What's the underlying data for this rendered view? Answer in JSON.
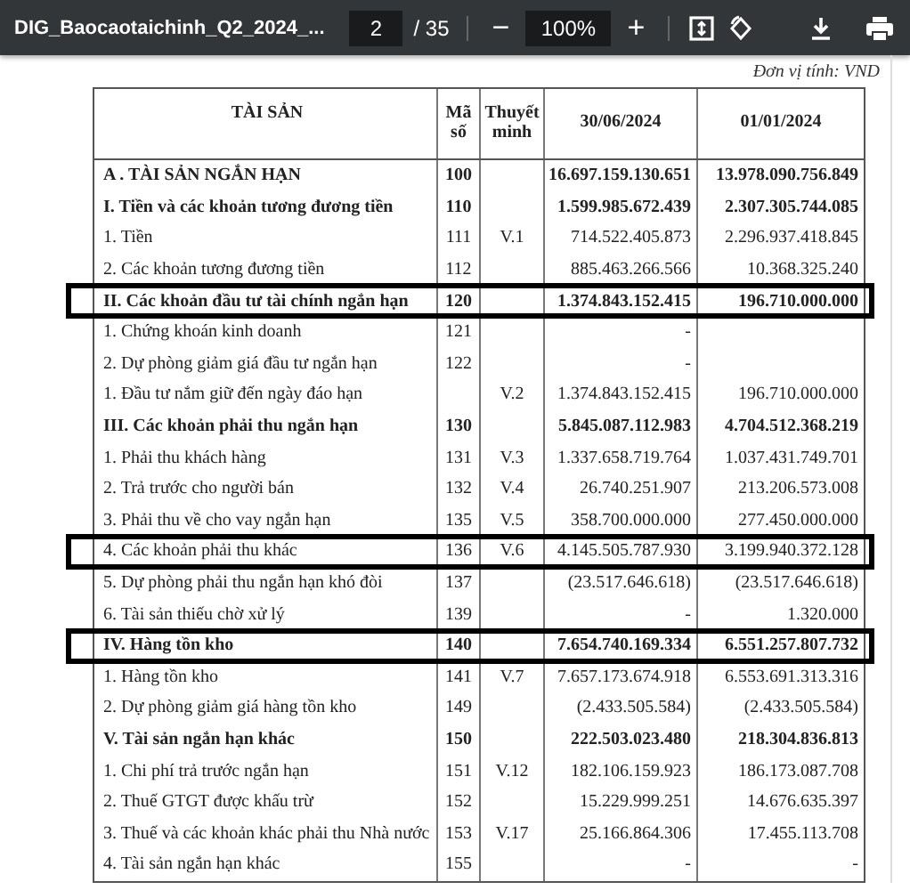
{
  "toolbar": {
    "file_name": "DIG_Baocaotaichinh_Q2_2024_...",
    "page_number": "2",
    "page_count": "/ 35",
    "zoom": "100%",
    "zoom_out": "−",
    "zoom_in": "+"
  },
  "unit": "Đơn vị tính: VND",
  "table": {
    "columns": [
      "TÀI SẢN",
      "Mã số",
      "Thuyết minh",
      "30/06/2024",
      "01/01/2024"
    ],
    "rows": [
      {
        "cells": [
          "A . TÀI SẢN NGẮN HẠN",
          "100",
          "",
          "16.697.159.130.651",
          "13.978.090.756.849"
        ],
        "bold": true,
        "highlighted": false
      },
      {
        "cells": [
          "I. Tiền và các khoản tương đương tiền",
          "110",
          "",
          "1.599.985.672.439",
          "2.307.305.744.085"
        ],
        "bold": true,
        "highlighted": false
      },
      {
        "cells": [
          "1. Tiền",
          "111",
          "V.1",
          "714.522.405.873",
          "2.296.937.418.845"
        ],
        "bold": false,
        "highlighted": false
      },
      {
        "cells": [
          "2. Các khoản tương đương tiền",
          "112",
          "",
          "885.463.266.566",
          "10.368.325.240"
        ],
        "bold": false,
        "highlighted": false
      },
      {
        "cells": [
          "II. Các khoản đầu tư tài chính ngắn hạn",
          "120",
          "",
          "1.374.843.152.415",
          "196.710.000.000"
        ],
        "bold": true,
        "highlighted": true
      },
      {
        "cells": [
          "1. Chứng khoán kinh doanh",
          "121",
          "",
          "-",
          ""
        ],
        "bold": false,
        "highlighted": false
      },
      {
        "cells": [
          "2. Dự phòng giảm giá đầu tư ngắn hạn",
          "122",
          "",
          "-",
          ""
        ],
        "bold": false,
        "highlighted": false
      },
      {
        "cells": [
          "1. Đầu tư nắm giữ đến ngày đáo hạn",
          "",
          "V.2",
          "1.374.843.152.415",
          "196.710.000.000"
        ],
        "bold": false,
        "highlighted": false
      },
      {
        "cells": [
          "III. Các khoản phải thu ngắn hạn",
          "130",
          "",
          "5.845.087.112.983",
          "4.704.512.368.219"
        ],
        "bold": true,
        "highlighted": false
      },
      {
        "cells": [
          "1. Phải thu khách hàng",
          "131",
          "V.3",
          "1.337.658.719.764",
          "1.037.431.749.701"
        ],
        "bold": false,
        "highlighted": false
      },
      {
        "cells": [
          "2. Trả trước cho người bán",
          "132",
          "V.4",
          "26.740.251.907",
          "213.206.573.008"
        ],
        "bold": false,
        "highlighted": false
      },
      {
        "cells": [
          "3. Phải thu về cho vay ngắn hạn",
          "135",
          "V.5",
          "358.700.000.000",
          "277.450.000.000"
        ],
        "bold": false,
        "highlighted": false
      },
      {
        "cells": [
          "4. Các khoản phải thu khác",
          "136",
          "V.6",
          "4.145.505.787.930",
          "3.199.940.372.128"
        ],
        "bold": false,
        "highlighted": true
      },
      {
        "cells": [
          "5. Dự phòng phải thu ngắn hạn khó đòi",
          "137",
          "",
          "(23.517.646.618)",
          "(23.517.646.618)"
        ],
        "bold": false,
        "highlighted": false
      },
      {
        "cells": [
          "6. Tài sản thiếu chờ xử lý",
          "139",
          "",
          "-",
          "1.320.000"
        ],
        "bold": false,
        "highlighted": false
      },
      {
        "cells": [
          "IV. Hàng tồn kho",
          "140",
          "",
          "7.654.740.169.334",
          "6.551.257.807.732"
        ],
        "bold": true,
        "highlighted": true
      },
      {
        "cells": [
          "1. Hàng tồn kho",
          "141",
          "V.7",
          "7.657.173.674.918",
          "6.553.691.313.316"
        ],
        "bold": false,
        "highlighted": false
      },
      {
        "cells": [
          "2. Dự phòng giảm giá hàng tồn kho",
          "149",
          "",
          "(2.433.505.584)",
          "(2.433.505.584)"
        ],
        "bold": false,
        "highlighted": false
      },
      {
        "cells": [
          "V. Tài sản ngắn hạn khác",
          "150",
          "",
          "222.503.023.480",
          "218.304.836.813"
        ],
        "bold": true,
        "highlighted": false
      },
      {
        "cells": [
          "1. Chi phí trả trước ngắn hạn",
          "151",
          "V.12",
          "182.106.159.923",
          "186.173.087.708"
        ],
        "bold": false,
        "highlighted": false
      },
      {
        "cells": [
          "2. Thuế GTGT được khấu trừ",
          "152",
          "",
          "15.229.999.251",
          "14.676.635.397"
        ],
        "bold": false,
        "highlighted": false
      },
      {
        "cells": [
          "3. Thuế và các khoản khác phải thu Nhà nước",
          "153",
          "V.17",
          "25.166.864.306",
          "17.455.113.708"
        ],
        "bold": false,
        "highlighted": false
      },
      {
        "cells": [
          "4. Tài sản ngắn hạn khác",
          "155",
          "",
          "-",
          "-"
        ],
        "bold": false,
        "highlighted": false
      }
    ]
  }
}
